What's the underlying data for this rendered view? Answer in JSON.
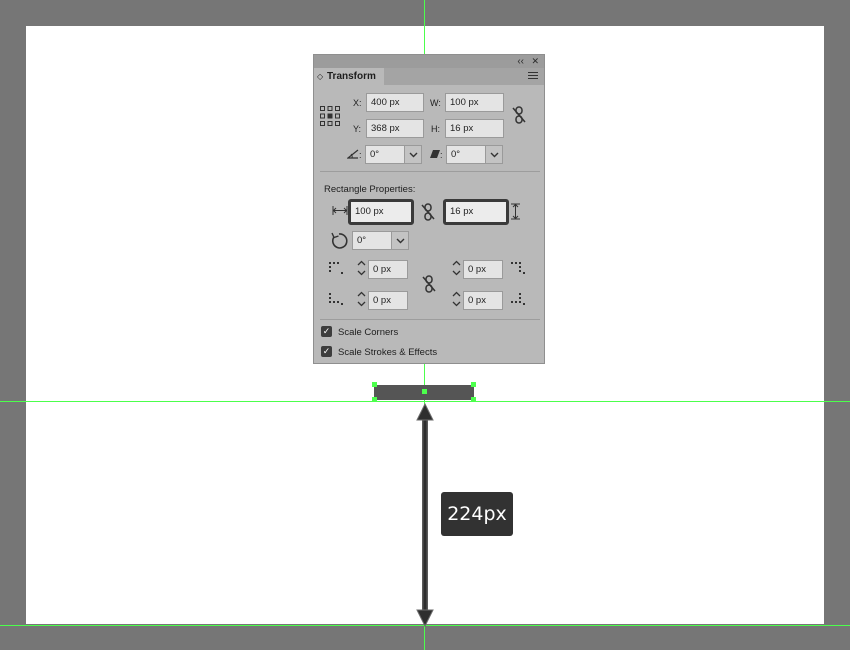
{
  "panel": {
    "collapse_glyph": "‹‹",
    "close_glyph": "✕",
    "tab_label": "Transform",
    "tab_chevron": "◇",
    "menu_icon": "panel-menu-icon",
    "x_label": "X:",
    "x_value": "400 px",
    "y_label": "Y:",
    "y_value": "368 px",
    "w_label": "W:",
    "w_value": "100 px",
    "h_label": "H:",
    "h_value": "16 px",
    "rotate_label": ":",
    "rotate_value": "0°",
    "shear_label": ":",
    "shear_value": "0°",
    "rect_section_title": "Rectangle Properties:",
    "rect_width": "100 px",
    "rect_height": "16 px",
    "rect_rotation": "0°",
    "corner_tl": "0 px",
    "corner_tr": "0 px",
    "corner_bl": "0 px",
    "corner_br": "0 px",
    "scale_corners_label": "Scale Corners",
    "scale_strokes_label": "Scale Strokes & Effects",
    "scale_corners_checked": true,
    "scale_strokes_checked": true
  },
  "measurement": {
    "label": "224px"
  },
  "colors": {
    "guide": "#4cff4c",
    "pasteboard": "#767676",
    "artboard": "#ffffff",
    "panel_bg": "#b9b9b9",
    "tooltip_bg": "#323232",
    "arrow": "#3a3a3a"
  }
}
